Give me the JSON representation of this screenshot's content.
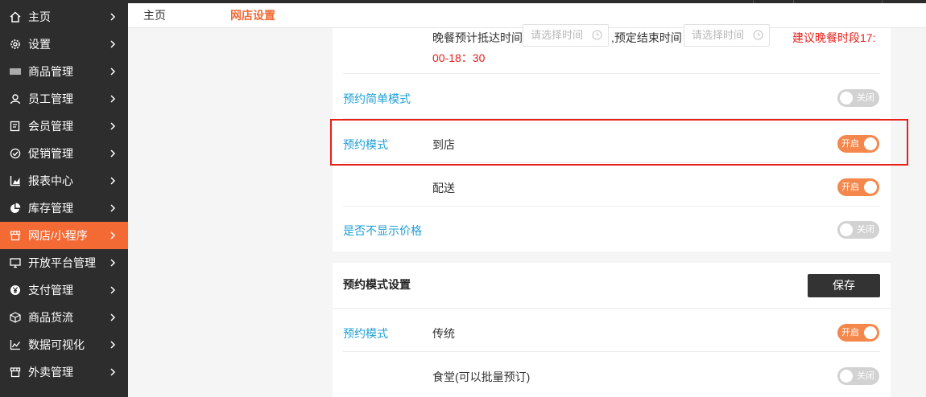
{
  "sidebar": {
    "items": [
      {
        "label": "主页",
        "icon": "home-icon"
      },
      {
        "label": "设置",
        "icon": "gear-icon"
      },
      {
        "label": "商品管理",
        "icon": "barcode-icon"
      },
      {
        "label": "员工管理",
        "icon": "user-icon"
      },
      {
        "label": "会员管理",
        "icon": "member-card-icon"
      },
      {
        "label": "促销管理",
        "icon": "check-circle-icon"
      },
      {
        "label": "报表中心",
        "icon": "bar-chart-icon"
      },
      {
        "label": "库存管理",
        "icon": "pie-chart-icon"
      },
      {
        "label": "网店/小程序",
        "icon": "store-icon",
        "active": true
      },
      {
        "label": "开放平台管理",
        "icon": "monitor-icon"
      },
      {
        "label": "支付管理",
        "icon": "yuan-icon"
      },
      {
        "label": "商品货流",
        "icon": "cube-icon"
      },
      {
        "label": "数据可视化",
        "icon": "line-chart-icon"
      },
      {
        "label": "外卖管理",
        "icon": "shop-icon"
      }
    ]
  },
  "tabs": {
    "home": "主页",
    "shop_settings": "网店设置"
  },
  "dinner": {
    "arrival_label": "晚餐预计抵达时间",
    "arrival_placeholder": "请选择时间",
    "end_label": ",预定结束时间",
    "end_placeholder": "请选择时间",
    "suggest_line1": "建议晚餐时段17:",
    "suggest_line2": "00-18：30"
  },
  "simple_mode": {
    "label": "预约简单模式",
    "switch": "关闭"
  },
  "reserve_mode": {
    "label": "预约模式",
    "to_store": "到店",
    "to_store_switch": "开启",
    "delivery": "配送",
    "delivery_switch": "开启"
  },
  "hide_price": {
    "label": "是否不显示价格",
    "switch": "关闭"
  },
  "reserve_settings": {
    "title": "预约模式设置",
    "save": "保存",
    "mode_label": "预约模式",
    "traditional": "传统",
    "traditional_switch": "开启",
    "canteen": "食堂(可以批量预订)",
    "canteen_switch": "关闭"
  },
  "colors": {
    "accent": "#f46a34",
    "sidebar_bg": "#2d2d2d",
    "link_blue": "#1e9fd6",
    "alert_red": "#e8201a",
    "switch_on": "#f4884c",
    "switch_off": "#d2d2d2"
  }
}
